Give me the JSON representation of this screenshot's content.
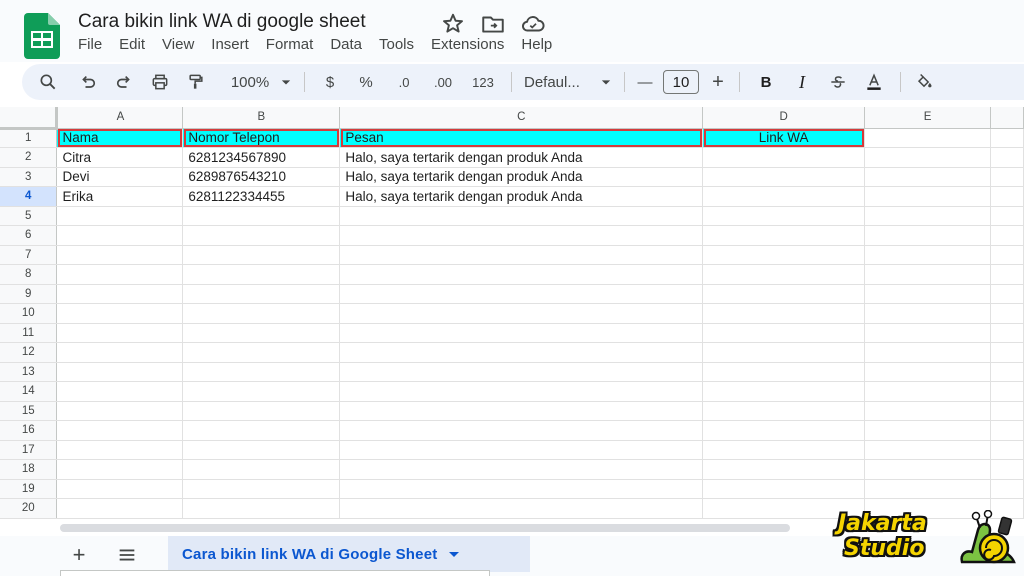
{
  "app": {
    "doc_title": "Cara bikin link WA di google sheet",
    "menu": [
      "File",
      "Edit",
      "View",
      "Insert",
      "Format",
      "Data",
      "Tools",
      "Extensions",
      "Help"
    ]
  },
  "toolbar": {
    "zoom": "100%",
    "currency": "$",
    "percent": "%",
    "decrease_decimal": ".0",
    "increase_decimal": ".00",
    "number_format": "123",
    "font": "Defaul...",
    "font_size": "10",
    "minus": "—",
    "plus": "+",
    "bold": "B",
    "italic": "I"
  },
  "sheet": {
    "columns": [
      "A",
      "B",
      "C",
      "D",
      "E"
    ],
    "rows": [
      {
        "num": "1",
        "cells": [
          "Nama",
          "Nomor Telepon",
          "Pesan",
          "Link WA",
          ""
        ]
      },
      {
        "num": "2",
        "cells": [
          "Citra",
          "6281234567890",
          "Halo, saya tertarik dengan produk Anda",
          "",
          ""
        ]
      },
      {
        "num": "3",
        "cells": [
          "Devi",
          "6289876543210",
          "Halo, saya tertarik dengan produk Anda",
          "",
          ""
        ]
      },
      {
        "num": "4",
        "cells": [
          "Erika",
          "6281122334455",
          "Halo, saya tertarik dengan produk Anda",
          "",
          ""
        ]
      },
      {
        "num": "5",
        "cells": [
          "",
          "",
          "",
          "",
          ""
        ]
      },
      {
        "num": "6",
        "cells": [
          "",
          "",
          "",
          "",
          ""
        ]
      },
      {
        "num": "7",
        "cells": [
          "",
          "",
          "",
          "",
          ""
        ]
      },
      {
        "num": "8",
        "cells": [
          "",
          "",
          "",
          "",
          ""
        ]
      },
      {
        "num": "9",
        "cells": [
          "",
          "",
          "",
          "",
          ""
        ]
      },
      {
        "num": "10",
        "cells": [
          "",
          "",
          "",
          "",
          ""
        ]
      },
      {
        "num": "11",
        "cells": [
          "",
          "",
          "",
          "",
          ""
        ]
      },
      {
        "num": "12",
        "cells": [
          "",
          "",
          "",
          "",
          ""
        ]
      },
      {
        "num": "13",
        "cells": [
          "",
          "",
          "",
          "",
          ""
        ]
      },
      {
        "num": "14",
        "cells": [
          "",
          "",
          "",
          "",
          ""
        ]
      },
      {
        "num": "15",
        "cells": [
          "",
          "",
          "",
          "",
          ""
        ]
      },
      {
        "num": "16",
        "cells": [
          "",
          "",
          "",
          "",
          ""
        ]
      },
      {
        "num": "17",
        "cells": [
          "",
          "",
          "",
          "",
          ""
        ]
      },
      {
        "num": "18",
        "cells": [
          "",
          "",
          "",
          "",
          ""
        ]
      },
      {
        "num": "19",
        "cells": [
          "",
          "",
          "",
          "",
          ""
        ]
      },
      {
        "num": "20",
        "cells": [
          "",
          "",
          "",
          "",
          ""
        ]
      }
    ],
    "header_fill": "#00ffff",
    "header_border": "#d43b3b",
    "selected_row": "4"
  },
  "bottom": {
    "add_sheet": "+",
    "tab_label": "Cara bikin link WA di Google Sheet"
  },
  "watermark": {
    "line1": "Jakarta",
    "line2": "Studio"
  }
}
